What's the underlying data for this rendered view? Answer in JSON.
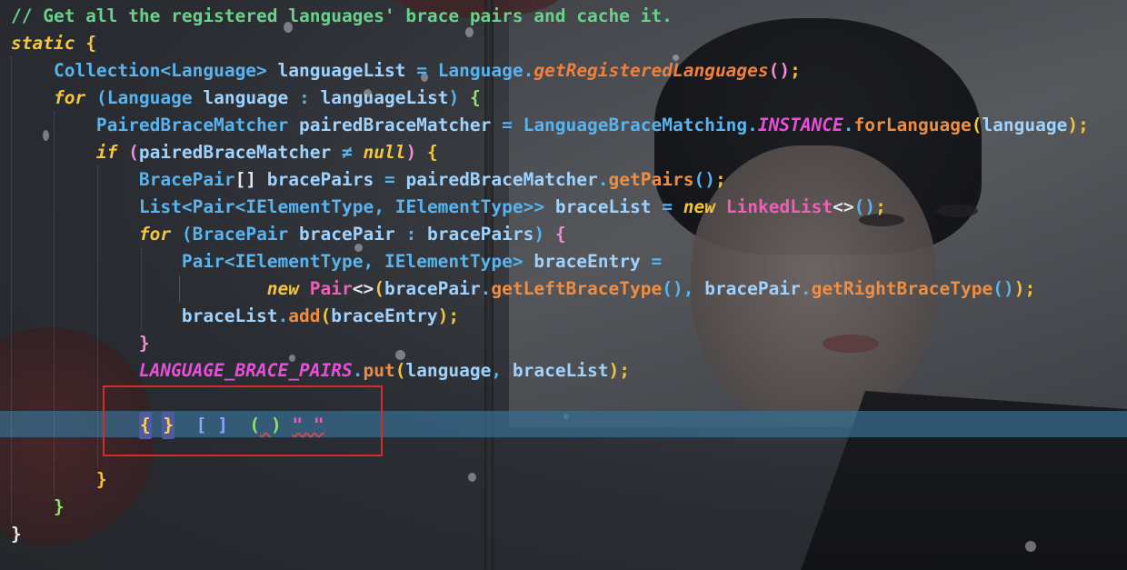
{
  "editor": {
    "lines": [
      [
        {
          "t": "// Get all the registered languages' brace pairs and cache it.",
          "c": "cmt"
        }
      ],
      [
        {
          "t": "static",
          "c": "kw"
        },
        {
          "t": " "
        },
        {
          "t": "{",
          "c": "b1"
        }
      ],
      [
        {
          "t": "    "
        },
        {
          "t": "Collection",
          "c": "typ"
        },
        {
          "t": "<",
          "c": "op"
        },
        {
          "t": "Language",
          "c": "typ"
        },
        {
          "t": ">",
          "c": "op"
        },
        {
          "t": " "
        },
        {
          "t": "languageList",
          "c": "id"
        },
        {
          "t": " "
        },
        {
          "t": "=",
          "c": "op"
        },
        {
          "t": " "
        },
        {
          "t": "Language",
          "c": "typ"
        },
        {
          "t": ".",
          "c": "dot"
        },
        {
          "t": "getRegisteredLanguages",
          "c": "sfn"
        },
        {
          "t": "()",
          "c": "b2"
        },
        {
          "t": ";",
          "c": "b1"
        }
      ],
      [
        {
          "t": "    "
        },
        {
          "t": "for",
          "c": "kw"
        },
        {
          "t": " "
        },
        {
          "t": "(",
          "c": "b3"
        },
        {
          "t": "Language",
          "c": "typ"
        },
        {
          "t": " "
        },
        {
          "t": "language",
          "c": "id"
        },
        {
          "t": " "
        },
        {
          "t": ":",
          "c": "op"
        },
        {
          "t": " "
        },
        {
          "t": "languageList",
          "c": "id"
        },
        {
          "t": ")",
          "c": "b3"
        },
        {
          "t": " "
        },
        {
          "t": "{",
          "c": "b4"
        }
      ],
      [
        {
          "t": "        "
        },
        {
          "t": "PairedBraceMatcher",
          "c": "typ"
        },
        {
          "t": " "
        },
        {
          "t": "pairedBraceMatcher",
          "c": "id"
        },
        {
          "t": " "
        },
        {
          "t": "=",
          "c": "op"
        },
        {
          "t": " "
        },
        {
          "t": "LanguageBraceMatching",
          "c": "typ"
        },
        {
          "t": ".",
          "c": "dot"
        },
        {
          "t": "INSTANCE",
          "c": "fld"
        },
        {
          "t": ".",
          "c": "dot"
        },
        {
          "t": "forLanguage",
          "c": "fn"
        },
        {
          "t": "(",
          "c": "b1"
        },
        {
          "t": "language",
          "c": "id"
        },
        {
          "t": ")",
          "c": "b1"
        },
        {
          "t": ";",
          "c": "b1"
        }
      ],
      [
        {
          "t": "        "
        },
        {
          "t": "if",
          "c": "kw"
        },
        {
          "t": " "
        },
        {
          "t": "(",
          "c": "b2"
        },
        {
          "t": "pairedBraceMatcher",
          "c": "id"
        },
        {
          "t": " "
        },
        {
          "t": "≠",
          "c": "op"
        },
        {
          "t": " "
        },
        {
          "t": "null",
          "c": "kw"
        },
        {
          "t": ")",
          "c": "b2"
        },
        {
          "t": " "
        },
        {
          "t": "{",
          "c": "b1"
        }
      ],
      [
        {
          "t": "            "
        },
        {
          "t": "BracePair",
          "c": "typ"
        },
        {
          "t": "[]",
          "c": "plain"
        },
        {
          "t": " "
        },
        {
          "t": "bracePairs",
          "c": "id"
        },
        {
          "t": " "
        },
        {
          "t": "=",
          "c": "op"
        },
        {
          "t": " "
        },
        {
          "t": "pairedBraceMatcher",
          "c": "id"
        },
        {
          "t": ".",
          "c": "dot"
        },
        {
          "t": "getPairs",
          "c": "fn"
        },
        {
          "t": "()",
          "c": "b3"
        },
        {
          "t": ";",
          "c": "b1"
        }
      ],
      [
        {
          "t": "            "
        },
        {
          "t": "List",
          "c": "typ"
        },
        {
          "t": "<",
          "c": "op"
        },
        {
          "t": "Pair",
          "c": "typ"
        },
        {
          "t": "<",
          "c": "op"
        },
        {
          "t": "IElementType",
          "c": "typ"
        },
        {
          "t": ",",
          "c": "op"
        },
        {
          "t": " "
        },
        {
          "t": "IElementType",
          "c": "typ"
        },
        {
          "t": ">>",
          "c": "op"
        },
        {
          "t": " "
        },
        {
          "t": "braceList",
          "c": "id"
        },
        {
          "t": " "
        },
        {
          "t": "=",
          "c": "op"
        },
        {
          "t": " "
        },
        {
          "t": "new",
          "c": "kw"
        },
        {
          "t": " "
        },
        {
          "t": "LinkedList",
          "c": "pink"
        },
        {
          "t": "<>",
          "c": "plain"
        },
        {
          "t": "()",
          "c": "b3"
        },
        {
          "t": ";",
          "c": "b1"
        }
      ],
      [
        {
          "t": "            "
        },
        {
          "t": "for",
          "c": "kw"
        },
        {
          "t": " "
        },
        {
          "t": "(",
          "c": "b3"
        },
        {
          "t": "BracePair",
          "c": "typ"
        },
        {
          "t": " "
        },
        {
          "t": "bracePair",
          "c": "id"
        },
        {
          "t": " "
        },
        {
          "t": ":",
          "c": "op"
        },
        {
          "t": " "
        },
        {
          "t": "bracePairs",
          "c": "id"
        },
        {
          "t": ")",
          "c": "b3"
        },
        {
          "t": " "
        },
        {
          "t": "{",
          "c": "b2"
        }
      ],
      [
        {
          "t": "                "
        },
        {
          "t": "Pair",
          "c": "typ"
        },
        {
          "t": "<",
          "c": "op"
        },
        {
          "t": "IElementType",
          "c": "typ"
        },
        {
          "t": ",",
          "c": "op"
        },
        {
          "t": " "
        },
        {
          "t": "IElementType",
          "c": "typ"
        },
        {
          "t": ">",
          "c": "op"
        },
        {
          "t": " "
        },
        {
          "t": "braceEntry",
          "c": "id"
        },
        {
          "t": " "
        },
        {
          "t": "=",
          "c": "op"
        }
      ],
      [
        {
          "t": "                        "
        },
        {
          "t": "new",
          "c": "kw"
        },
        {
          "t": " "
        },
        {
          "t": "Pair",
          "c": "pink"
        },
        {
          "t": "<>",
          "c": "plain"
        },
        {
          "t": "(",
          "c": "b1"
        },
        {
          "t": "bracePair",
          "c": "id"
        },
        {
          "t": ".",
          "c": "dot"
        },
        {
          "t": "getLeftBraceType",
          "c": "fn"
        },
        {
          "t": "()",
          "c": "b3"
        },
        {
          "t": ",",
          "c": "op"
        },
        {
          "t": " "
        },
        {
          "t": "bracePair",
          "c": "id"
        },
        {
          "t": ".",
          "c": "dot"
        },
        {
          "t": "getRightBraceType",
          "c": "fn"
        },
        {
          "t": "()",
          "c": "b3"
        },
        {
          "t": ")",
          "c": "b1"
        },
        {
          "t": ";",
          "c": "b1"
        }
      ],
      [
        {
          "t": "                "
        },
        {
          "t": "braceList",
          "c": "id"
        },
        {
          "t": ".",
          "c": "dot"
        },
        {
          "t": "add",
          "c": "fn"
        },
        {
          "t": "(",
          "c": "b1"
        },
        {
          "t": "braceEntry",
          "c": "id"
        },
        {
          "t": ")",
          "c": "b1"
        },
        {
          "t": ";",
          "c": "b1"
        }
      ],
      [
        {
          "t": "            "
        },
        {
          "t": "}",
          "c": "b2"
        }
      ],
      [
        {
          "t": "            "
        },
        {
          "t": "LANGUAGE_BRACE_PAIRS",
          "c": "fld"
        },
        {
          "t": ".",
          "c": "dot"
        },
        {
          "t": "put",
          "c": "fn"
        },
        {
          "t": "(",
          "c": "b1"
        },
        {
          "t": "language",
          "c": "id"
        },
        {
          "t": ",",
          "c": "op"
        },
        {
          "t": " "
        },
        {
          "t": "braceList",
          "c": "id"
        },
        {
          "t": ")",
          "c": "b1"
        },
        {
          "t": ";",
          "c": "b1"
        }
      ],
      [
        {
          "t": ""
        }
      ],
      [
        {
          "t": "            "
        },
        {
          "t": "{",
          "c": "br-curly-l"
        },
        {
          "t": " "
        },
        {
          "t": "}",
          "c": "br-curly-r"
        },
        {
          "t": "  "
        },
        {
          "t": "[ ]",
          "c": "br-sq"
        },
        {
          "t": "  "
        },
        {
          "t": "(",
          "c": "br-par"
        },
        {
          "t": " ",
          "c": "paren-u"
        },
        {
          "t": ")",
          "c": "br-par"
        },
        {
          "t": " "
        },
        {
          "t": "\" \"",
          "c": "str-q"
        }
      ],
      [
        {
          "t": ""
        }
      ],
      [
        {
          "t": "        "
        },
        {
          "t": "}",
          "c": "b1"
        }
      ],
      [
        {
          "t": "    "
        },
        {
          "t": "}",
          "c": "b4"
        }
      ],
      [
        {
          "t": "}",
          "c": "plain"
        }
      ]
    ]
  },
  "colors": {
    "accent_selection": "#386e91",
    "highlight_box": "#d62b2b",
    "comment": "#6ad18a",
    "keyword": "#f4c43b",
    "type": "#59b3ee",
    "field": "#e84fd8",
    "method": "#ef8d43"
  }
}
